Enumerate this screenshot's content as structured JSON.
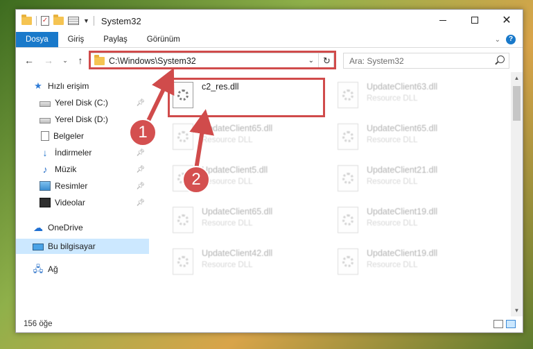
{
  "window": {
    "title": "System32"
  },
  "ribbon": {
    "tabs": [
      "Dosya",
      "Giriş",
      "Paylaş",
      "Görünüm"
    ],
    "help": "?"
  },
  "nav": {
    "address": "C:\\Windows\\System32",
    "search_placeholder": "Ara: System32"
  },
  "sidebar": {
    "items": [
      {
        "label": "Hızlı erişim",
        "icon": "star-icon"
      },
      {
        "label": "Yerel Disk (C:)",
        "icon": "drive-icon"
      },
      {
        "label": "Yerel Disk (D:)",
        "icon": "drive-icon"
      },
      {
        "label": "Belgeler",
        "icon": "document-icon"
      },
      {
        "label": "İndirmeler",
        "icon": "download-icon"
      },
      {
        "label": "Müzik",
        "icon": "music-icon"
      },
      {
        "label": "Resimler",
        "icon": "pictures-icon"
      },
      {
        "label": "Videolar",
        "icon": "video-icon"
      },
      {
        "label": "OneDrive",
        "icon": "cloud-icon"
      },
      {
        "label": "Bu bilgisayar",
        "icon": "computer-icon"
      },
      {
        "label": "Ağ",
        "icon": "network-icon"
      }
    ]
  },
  "files": [
    {
      "name": "c2_res.dll",
      "type": ""
    },
    {
      "name": "UpdateClient63.dll",
      "type": "Resource DLL"
    },
    {
      "name": "UpdateClient65.dll",
      "type": "Resource DLL"
    },
    {
      "name": "UpdateClient65.dll",
      "type": "Resource DLL"
    },
    {
      "name": "UpdateClient5.dll",
      "type": "Resource DLL"
    },
    {
      "name": "UpdateClient21.dll",
      "type": "Resource DLL"
    },
    {
      "name": "UpdateClient65.dll",
      "type": "Resource DLL"
    },
    {
      "name": "UpdateClient19.dll",
      "type": "Resource DLL"
    },
    {
      "name": "UpdateClient42.dll",
      "type": "Resource DLL"
    },
    {
      "name": "UpdateClient19.dll",
      "type": "Resource DLL"
    }
  ],
  "status": {
    "count": "156 öğe"
  },
  "annotations": {
    "step1": "1",
    "step2": "2",
    "color": "#d04b4b"
  }
}
